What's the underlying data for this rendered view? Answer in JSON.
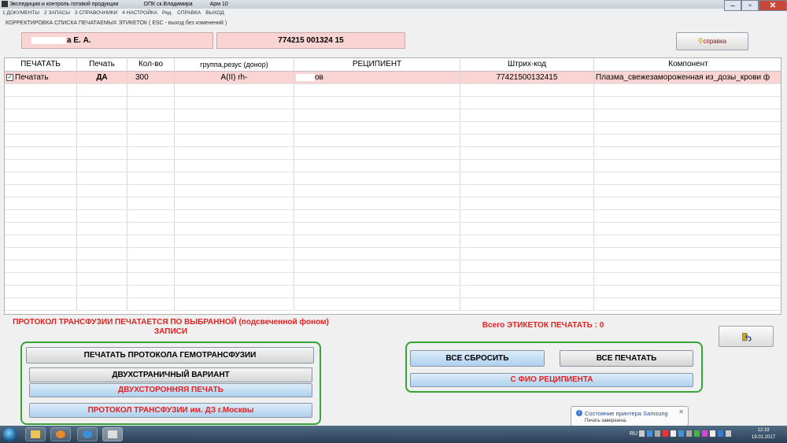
{
  "window": {
    "title": "Экспедиция и контроль готовой продукции",
    "org": "ОПК ск.Владимира",
    "workstation": "Арм 10"
  },
  "menu": [
    "1 ДОКУМЕНТЫ",
    "2 ЗАПАСЫ",
    "3 СПРАВОЧНИКИ",
    "4 НАСТРОЙКА",
    "Ред.",
    "СПРАВКА",
    "ВЫХОД"
  ],
  "mode_line": "КОРРЕКТИРОВКА  СПИСКА ПЕЧАТАЕМЫХ  ЭТИКЕТОК  ( ESC - выход без изменений )",
  "header": {
    "patient_name_visible": "а Е. А.",
    "codes": "774215  001324  15",
    "help_label": "справка"
  },
  "grid": {
    "columns": [
      "ПЕЧАТАТЬ",
      "Печать",
      "Кол-во",
      "группа,резус (донор)",
      "РЕЦИПИЕНТ",
      "Штрих-код",
      "Компонент"
    ],
    "rows": [
      {
        "print": "Печатать",
        "flag": "ДА",
        "qty": "300",
        "group": "A(II)  rh-",
        "recipient": "ов",
        "barcode": "77421500132415",
        "component": "Плазма_свежезамороженная  из_дозы_крови ф"
      }
    ]
  },
  "protocol_note": "ПРОТОКОЛ ТРАНСФУЗИИ ПЕЧАТАЕТСЯ ПО ВЫБРАННОЙ (подсвеченной фоном) ЗАПИСИ",
  "labels_total": "Всего ЭТИКЕТОК ПЕЧАТАТЬ :  0",
  "left_buttons": {
    "print_protocol": "ПЕЧАТАТЬ  ПРОТОКОЛА ГЕМОТРАНСФУЗИИ",
    "two_page": "ДВУХСТРАНИЧНЫЙ ВАРИАНТ",
    "duplex": "ДВУХСТОРОННЯЯ ПЕЧАТЬ",
    "moscow_protocol": "ПРОТОКОЛ ТРАНСФУЗИИ им. ДЗ г.Москвы"
  },
  "right_buttons": {
    "reset_all": "ВСЕ СБРОСИТЬ",
    "print_all": "ВСЕ ПЕЧАТАТЬ",
    "with_name": "С ФИО РЕЦИПИЕНТА"
  },
  "notification": {
    "title": "Состояние принтера Samsung",
    "text": "Печать завершена."
  },
  "taskbar": {
    "lang": "RU",
    "time": "12:19",
    "date": "19.01.2017"
  }
}
